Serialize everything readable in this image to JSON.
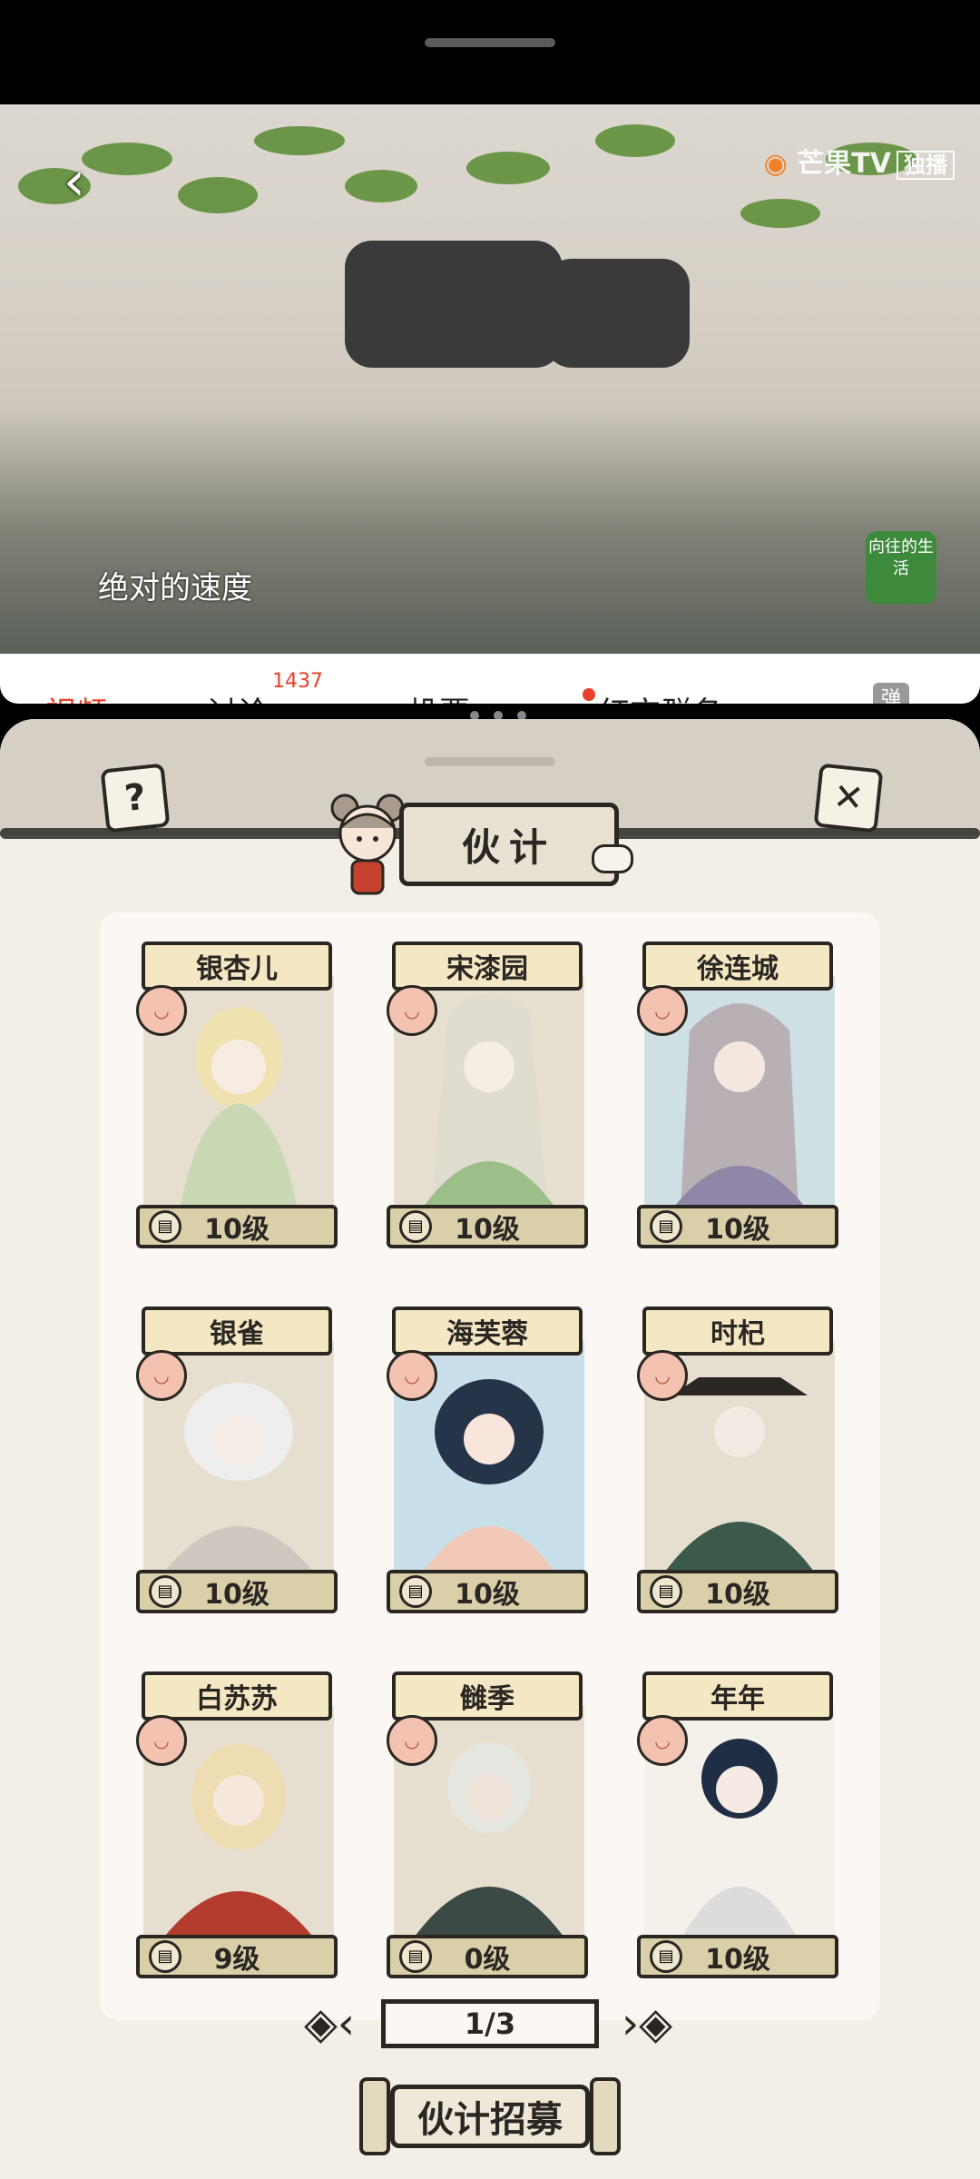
{
  "video": {
    "subtitle": "绝对的速度",
    "channel_logo": "芒果TV",
    "channel_tag": "独播",
    "show_badge": "向往的生活"
  },
  "tabs": [
    {
      "label": "视频"
    },
    {
      "label": "讨论"
    },
    {
      "label": "投票"
    },
    {
      "label": "红衣群名"
    }
  ],
  "tab_count": "1437",
  "tab_extra": "弹",
  "sheet": {
    "title": "伙计",
    "help_icon": "?",
    "close_icon": "✕"
  },
  "cards": [
    {
      "name": "银杏儿",
      "level": "10级"
    },
    {
      "name": "宋漆园",
      "level": "10级"
    },
    {
      "name": "徐连城",
      "level": "10级"
    },
    {
      "name": "银雀",
      "level": "10级"
    },
    {
      "name": "海芙蓉",
      "level": "10级"
    },
    {
      "name": "时杞",
      "level": "10级"
    },
    {
      "name": "白苏苏",
      "level": "9级"
    },
    {
      "name": "雠季",
      "level": "0级"
    },
    {
      "name": "年年",
      "level": "10级"
    }
  ],
  "pagination": {
    "label": "1/3",
    "current": 1,
    "total": 3
  },
  "recruit_button": "伙计招募",
  "colors": {
    "ink": "#2a2723",
    "paper": "#f3efe6",
    "accent": "#e8402a"
  }
}
